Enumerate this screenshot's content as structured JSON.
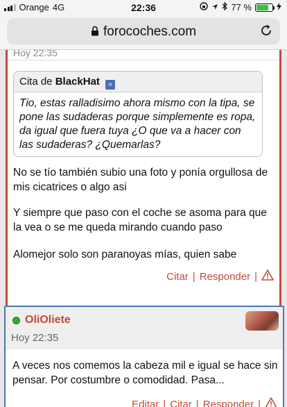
{
  "status_bar": {
    "carrier": "Orange",
    "network": "4G",
    "time": "22:36",
    "battery_percent": "77 %",
    "battery_level": 0.77
  },
  "browser": {
    "url": "forocoches.com"
  },
  "post1": {
    "date": "Hoy 22:35",
    "quote_prefix": "Cita de",
    "quote_author": "BlackHat",
    "quote_text": "Tio, estas ralladisimo ahora mismo con la tipa, se pone las sudaderas porque simplemente es ropa, da igual que fuera tuya ¿O que va a hacer con las sudaderas? ¿Quemarlas?",
    "paragraphs": [
      "No se tío también subio una foto y ponía orgullosa de mis cicatrices o algo asi",
      "Y siempre que paso con el coche se asoma para que la vea o se me queda mirando cuando paso",
      "Alomejor solo son paranoyas mías, quien sabe"
    ],
    "actions": {
      "quote": "Citar",
      "reply": "Responder"
    }
  },
  "post2": {
    "username": "OliOliete",
    "date": "Hoy 22:35",
    "text": "A veces nos comemos la cabeza mil e igual se hace sin pensar. Por costumbre o comodidad. Pasa...",
    "actions": {
      "edit": "Editar",
      "quote": "Citar",
      "reply": "Responder"
    }
  },
  "colors": {
    "accent": "#c04a35",
    "post2_border": "#4a78b8",
    "online": "#2fae2f"
  }
}
